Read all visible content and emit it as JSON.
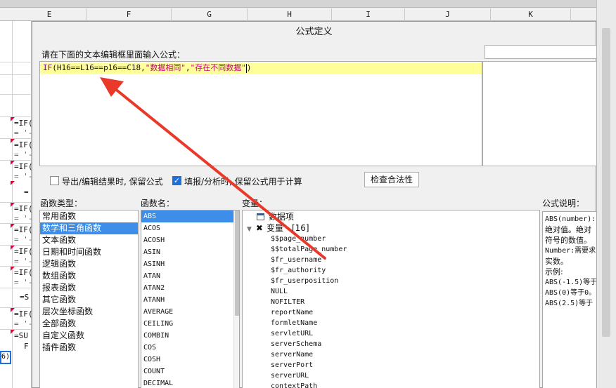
{
  "sheet": {
    "columns": [
      "E",
      "F",
      "G",
      "H",
      "I",
      "J",
      "K"
    ],
    "cells": [
      "=IF(",
      "= '-(",
      "=IF(",
      "= '-(",
      "=IF(",
      "= '-(",
      "=",
      "=IF(",
      "= '-(",
      "=IF(",
      "= '-(",
      "=IF(",
      "= '-(",
      "=IF(",
      "= '-(",
      "=S",
      "=IF(",
      "= '-(",
      "=SU",
      "F"
    ],
    "selected_cell": "6)"
  },
  "dialog": {
    "title": "公式定义",
    "prompt": "请在下面的文本编辑框里面输入公式：",
    "formula": {
      "fn": "IF",
      "expr": "(H16==L16==p16==C18,",
      "str1": "\"数据相同\"",
      "comma": ",",
      "str2": "\"存在不同数据\"",
      "close": ")"
    },
    "keep_formula_export": "导出/编辑结果时, 保留公式",
    "keep_formula_fill": "填报/分析时, 保留公式用于计算",
    "check_button": "检查合法性",
    "func_type_label": "函数类型：",
    "func_name_label": "函数名：",
    "variable_label": "变量：",
    "desc_label": "公式说明：",
    "func_types": [
      "常用函数",
      "数学和三角函数",
      "文本函数",
      "日期和时间函数",
      "逻辑函数",
      "数组函数",
      "报表函数",
      "其它函数",
      "层次坐标函数",
      "全部函数",
      "自定义函数",
      "插件函数"
    ],
    "func_names": [
      "ABS",
      "ACOS",
      "ACOSH",
      "ASIN",
      "ASINH",
      "ATAN",
      "ATAN2",
      "ATANH",
      "AVERAGE",
      "CEILING",
      "COMBIN",
      "COS",
      "COSH",
      "COUNT",
      "DECIMAL"
    ],
    "var_tree": {
      "data_item": "数据项",
      "variables": "变量 - [16]",
      "items": [
        "$$page_number",
        "$$totalPage_number",
        "$fr_username",
        "$fr_authority",
        "$fr_userposition",
        "NULL",
        "NOFILTER",
        "reportName",
        "formletName",
        "servletURL",
        "serverSchema",
        "serverName",
        "serverPort",
        "serverURL",
        "contextPath"
      ]
    },
    "description": [
      "ABS(number):",
      "绝对值。绝对",
      "符号的数值。",
      "Number:需要求",
      "实数。",
      "示例:",
      "ABS(-1.5)等于",
      "ABS(0)等于0。",
      "ABS(2.5)等于"
    ]
  },
  "colors": {
    "selection": "#3c8ee8",
    "editor_highlight": "#ffff99",
    "arrow": "#e8392b",
    "function_text": "#7a007a",
    "string_text": "#c0007a"
  }
}
